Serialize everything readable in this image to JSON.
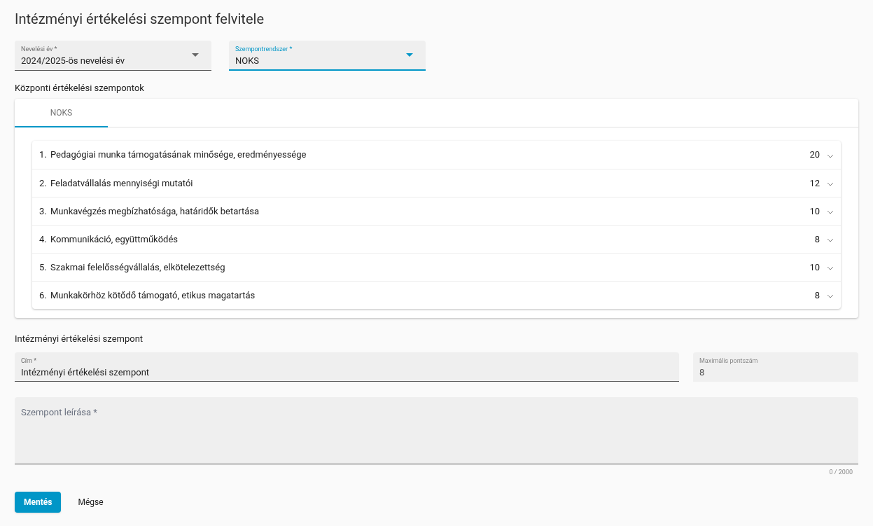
{
  "page_title": "Intézményi értékelési szempont felvitele",
  "selects": [
    {
      "label": "Nevelési év *",
      "value": "2024/2025-ös nevelési év",
      "focused": false
    },
    {
      "label": "Szempontrendszer *",
      "value": "NOKS",
      "focused": true
    }
  ],
  "central_section": {
    "heading": "Központi értékelési szempontok",
    "tabs": [
      {
        "label": "NOKS",
        "selected": true
      }
    ],
    "criteria": [
      {
        "number": "1.",
        "title": "Pedagógiai munka támogatásának minősége, eredményessége",
        "points": "20",
        "expanded": false
      },
      {
        "number": "2.",
        "title": "Feladatvállalás mennyiségi mutatói",
        "points": "12",
        "expanded": false
      },
      {
        "number": "3.",
        "title": "Munkavégzés megbízhatósága, határidők betartása",
        "points": "10",
        "expanded": false
      },
      {
        "number": "4.",
        "title": "Kommunikáció, együttműködés",
        "points": "8",
        "expanded": false
      },
      {
        "number": "5.",
        "title": "Szakmai felelősségvállalás, elkötelezettség",
        "points": "10",
        "expanded": false
      },
      {
        "number": "6.",
        "title": "Munkakörhöz kötődő támogató, etikus magatartás",
        "points": "8",
        "expanded": false
      }
    ]
  },
  "institutional_section": {
    "heading": "Intézményi értékelési szempont",
    "title_field": {
      "label": "Cím *",
      "value": "Intézményi értékelési szempont"
    },
    "max_points_field": {
      "label": "Maximális pontszám",
      "value": "8",
      "disabled": true
    },
    "description_field": {
      "placeholder": "Szempont leírása *",
      "counter": "0 / 2000"
    }
  },
  "buttons": [
    {
      "label": "Mentés",
      "kind": "primary"
    },
    {
      "label": "Mégse",
      "kind": "text"
    }
  ]
}
